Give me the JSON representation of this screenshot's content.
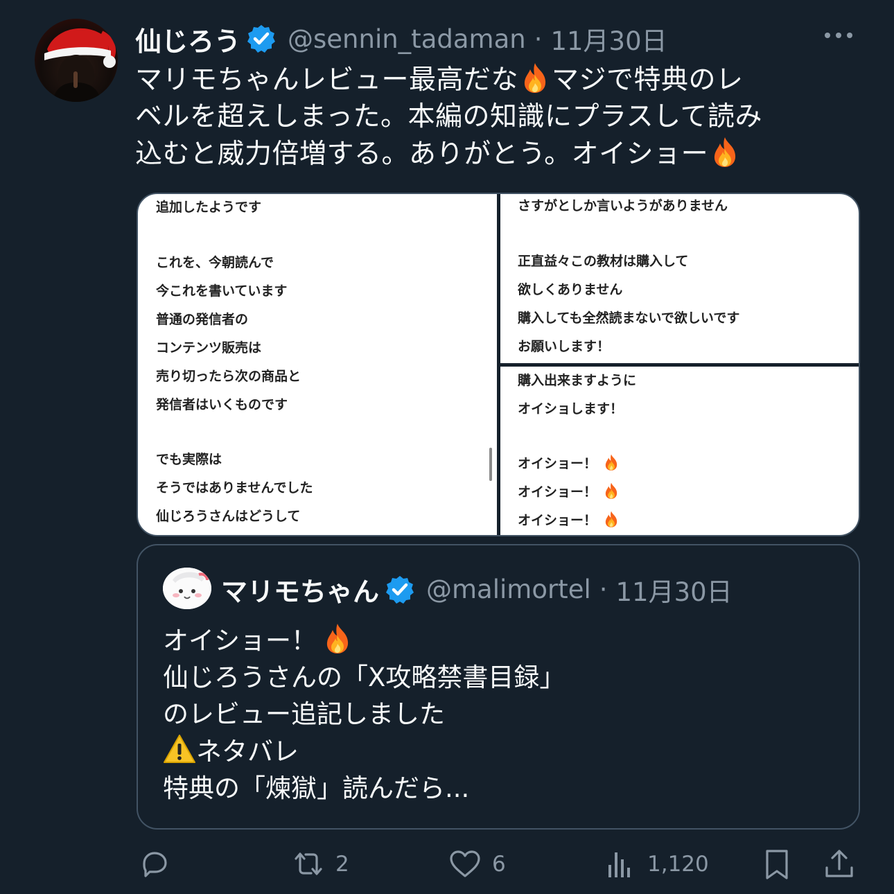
{
  "tweet": {
    "author_name": "仙じろう",
    "author_handle": "@sennin_tadaman",
    "date": "11月30日",
    "separator": "·",
    "text_lines": [
      "マリモちゃんレビュー最高だな",
      "マジで特典のレ",
      "ベルを超えしまった。本編の知識にプラスして読み",
      "込むと威力倍増する。ありがとう。オイショー"
    ],
    "icons": {
      "verified": "verified-badge-icon",
      "more": "more-options-icon",
      "fire": "fire-emoji-icon"
    }
  },
  "media": {
    "left_lines": [
      "追加したようです",
      "",
      "これを、今朝読んで",
      "今これを書いています",
      "普通の発信者の",
      "コンテンツ販売は",
      "売り切ったら次の商品と",
      "発信者はいくものです",
      "",
      "でも実際は",
      "そうではありませんでした",
      "仙じろうさんはどうして"
    ],
    "right_top_lines": [
      "さすがとしか言いようがありません",
      "",
      "正直益々この教材は購入して",
      "欲しくありません",
      "購入しても全然読まないで欲しいです",
      "お願いします！"
    ],
    "right_bottom_lines": [
      "購入出来ますように",
      "オイショします！",
      "",
      "オイショー！",
      "オイショー！",
      "オイショー！"
    ]
  },
  "quote": {
    "author_name": "マリモちゃん",
    "author_handle": "@malimortel",
    "date": "11月30日",
    "separator": "·",
    "lines": [
      "オイショー！",
      "仙じろうさんの「X攻略禁書目録」",
      "のレビュー追記しました",
      "ネタバレ",
      "特典の「煉獄」読んだら..."
    ],
    "icons": {
      "warning": "warning-icon"
    }
  },
  "actions": {
    "reply": {
      "icon": "reply-icon",
      "count": ""
    },
    "retweet": {
      "icon": "retweet-icon",
      "count": "2"
    },
    "like": {
      "icon": "heart-icon",
      "count": "6"
    },
    "views": {
      "icon": "views-icon",
      "count": "1,120"
    },
    "bookmark": {
      "icon": "bookmark-icon"
    },
    "share": {
      "icon": "share-icon"
    }
  },
  "colors": {
    "background": "#15202b",
    "text": "#f7f9f9",
    "muted": "#8b98a5",
    "verified": "#1d9bf0",
    "border": "#425364"
  }
}
